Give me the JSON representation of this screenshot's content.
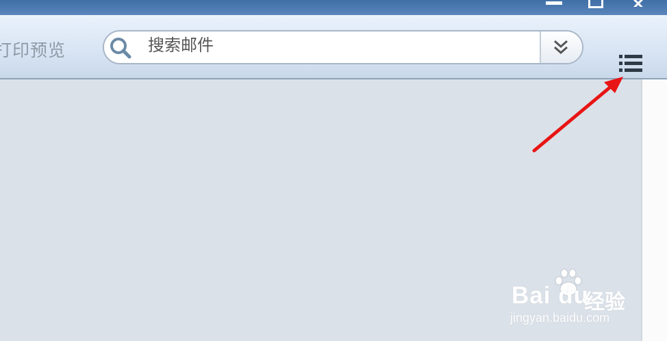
{
  "window": {
    "minimize_icon": "minimize-icon",
    "maximize_icon": "maximize-icon",
    "close_glyph": "✕"
  },
  "toolbar": {
    "print_preview_label": "打印预览",
    "search": {
      "placeholder": "搜索邮件",
      "icon": "search-icon",
      "dropdown_icon": "double-chevron-down-icon"
    },
    "menu_icon": "list-menu-icon"
  },
  "annotation": {
    "arrow_color": "#e81515"
  },
  "watermark": {
    "logo": "Bai du",
    "brand_suffix": "经验",
    "url": "jingyan.baidu.com"
  }
}
